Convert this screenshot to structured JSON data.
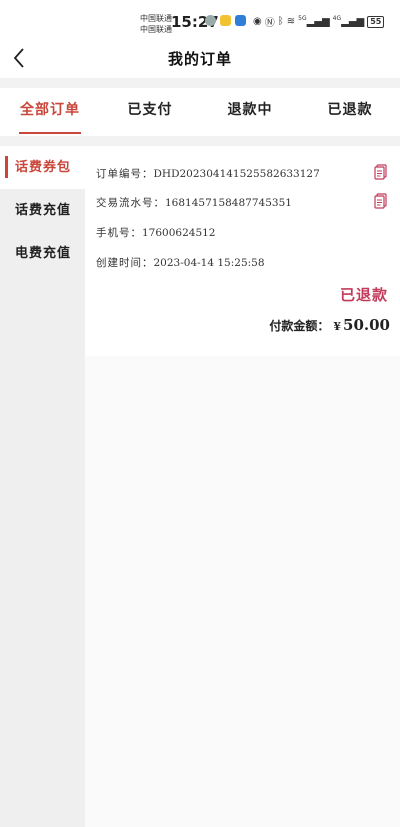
{
  "status_bar": {
    "carrier_1": "中国联通",
    "carrier_2": "中国联通",
    "time": "15:27",
    "signal_1": "5G",
    "signal_2": "4G",
    "battery": "55"
  },
  "header": {
    "title": "我的订单"
  },
  "tabs": [
    {
      "label": "全部订单",
      "active": true
    },
    {
      "label": "已支付",
      "active": false
    },
    {
      "label": "退款中",
      "active": false
    },
    {
      "label": "已退款",
      "active": false
    }
  ],
  "sidebar": {
    "items": [
      {
        "label": "话费券包",
        "active": true
      },
      {
        "label": "话费充值",
        "active": false
      },
      {
        "label": "电费充值",
        "active": false
      }
    ]
  },
  "order": {
    "order_no_label": "订单编号：",
    "order_no": "DHD20230414152558263312​7",
    "txn_no_label": "交易流水号：",
    "txn_no": "1681457158487745351",
    "phone_label": "手机号：",
    "phone": "17600624512",
    "created_label": "创建时间：",
    "created": "2023-04-14 15:25:58",
    "status": "已退款",
    "amount_label": "付款金额：",
    "currency": "¥",
    "amount": "50.00"
  },
  "colors": {
    "accent": "#c9473a",
    "status_refunded": "#c43a5a",
    "copy_icon": "#c43a5a"
  }
}
